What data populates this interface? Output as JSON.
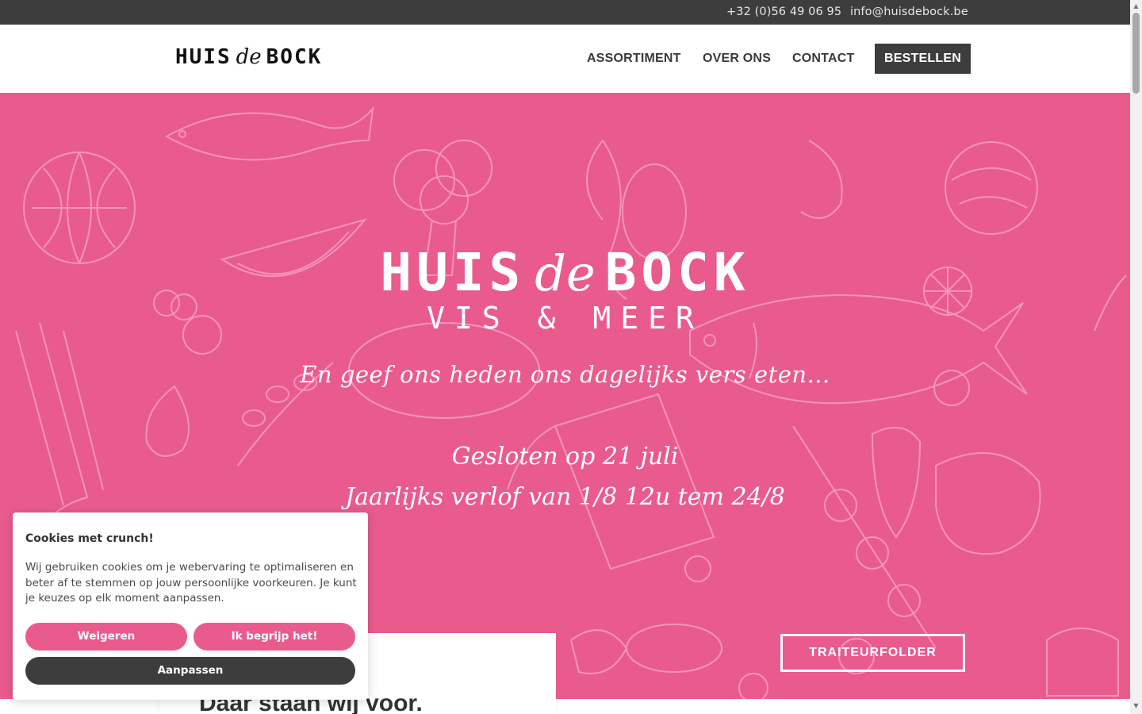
{
  "topbar": {
    "phone": "+32 (0)56 49 06 95",
    "email": "info@huisdebock.be"
  },
  "header": {
    "logo": {
      "part1": "HUIS",
      "part2": "de",
      "part3": "BOCK"
    },
    "nav": [
      "ASSORTIMENT",
      "OVER ONS",
      "CONTACT"
    ],
    "order_button": "BESTELLEN"
  },
  "hero": {
    "title": {
      "part1": "HUIS",
      "part2": "de",
      "part3": "BOCK"
    },
    "subtitle": "VIS & MEER",
    "tagline": "En geef ons heden ons dagelijks vers eten...",
    "notice_1": "Gesloten op 21 juli",
    "notice_2": "Jaarlijks verlof van 1/8 12u tem 24/8",
    "button": "TRAITEURFOLDER",
    "background_color": "#ea5b8d"
  },
  "card": {
    "heading": "Daar staan wij voor."
  },
  "cookie": {
    "title": "Cookies met crunch!",
    "text": "Wij gebruiken cookies om je webervaring te optimaliseren en beter af te stemmen op jouw persoonlijke voorkeuren. Je kunt je keuzes op elk moment aanpassen.",
    "reject": "Weigeren",
    "accept": "Ik begrijp het!",
    "customize": "Aanpassen",
    "accent_color": "#ea5b8d",
    "dark_color": "#3d3d3d"
  },
  "icons": {
    "scroll_up": "scroll-up-arrow-icon",
    "scroll_down": "scroll-down-arrow-icon"
  }
}
